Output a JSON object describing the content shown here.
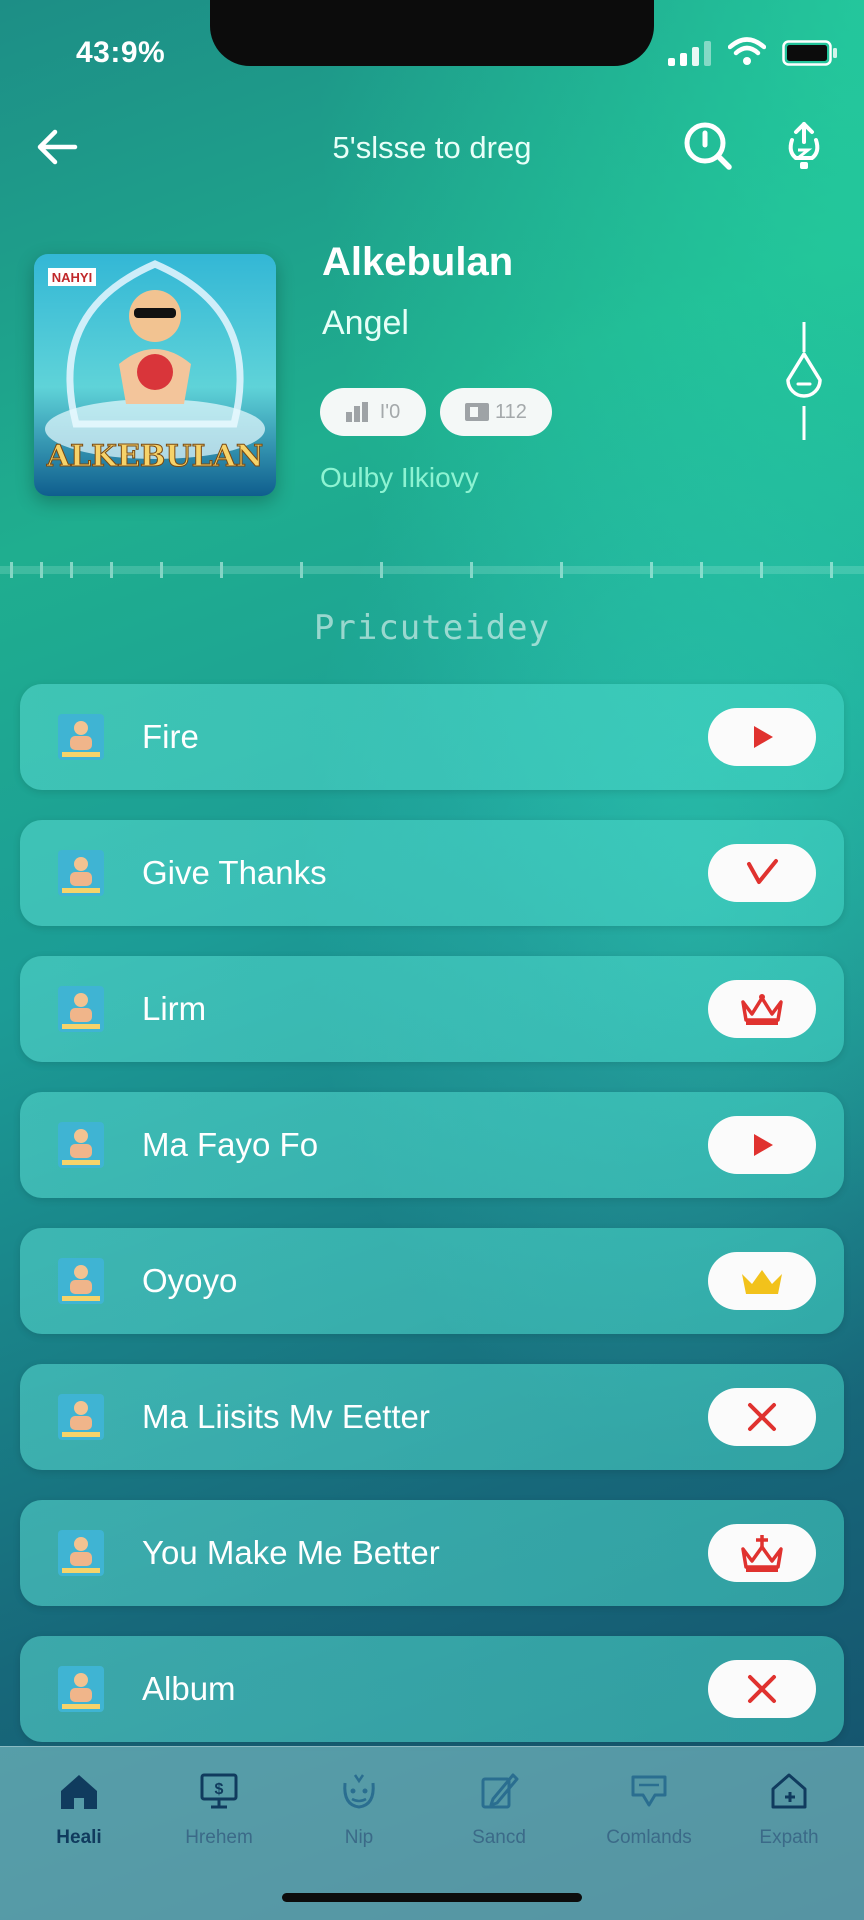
{
  "status_bar": {
    "time": "43:9%"
  },
  "header": {
    "title": "5'slsse to dreg",
    "back_icon": "arrow-left-icon",
    "search_icon": "search-icon",
    "share_icon": "share-icon"
  },
  "album": {
    "title": "Alkebulan",
    "artist": "Angel",
    "art_text_top": "NAHYI",
    "art_text_main": "ALKEBULAN",
    "stat_1": "I'0",
    "stat_2": "112",
    "subtitle": "Oulby Ilkiovy"
  },
  "section": {
    "heading": "Pricuteidey"
  },
  "tracks": [
    {
      "title": "Fire",
      "action_icon": "play-icon"
    },
    {
      "title": "Give Thanks",
      "action_icon": "check-icon"
    },
    {
      "title": "Lirm",
      "action_icon": "crown-icon"
    },
    {
      "title": "Ma Fayo Fo",
      "action_icon": "play-icon"
    },
    {
      "title": "Oyoyo",
      "action_icon": "crown-gold-icon"
    },
    {
      "title": "Ma Liisits Mv Eetter",
      "action_icon": "close-icon"
    },
    {
      "title": "You Make Me Better",
      "action_icon": "crown-icon"
    },
    {
      "title": "Album",
      "action_icon": "close-icon"
    }
  ],
  "bottom_nav": [
    {
      "label": "Heali",
      "icon": "home-icon",
      "active": true
    },
    {
      "label": "Hrehem",
      "icon": "monitor-dollar-icon"
    },
    {
      "label": "Nip",
      "icon": "smiley-icon"
    },
    {
      "label": "Sancd",
      "icon": "edit-icon"
    },
    {
      "label": "Comlands",
      "icon": "chat-icon"
    },
    {
      "label": "Expath",
      "icon": "house-plus-icon"
    }
  ],
  "colors": {
    "accent": "#1fae8f",
    "action_red": "#e0322f",
    "crown_gold": "#f2c21b",
    "nav_text": "#3b6a88"
  }
}
